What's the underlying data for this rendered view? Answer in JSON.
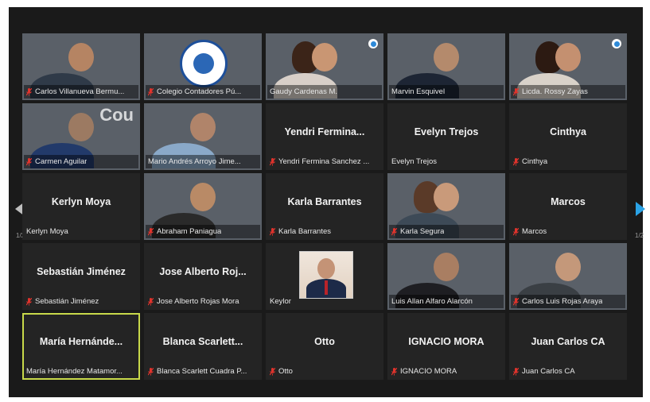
{
  "window": {
    "page_indicator_left": "1/2",
    "page_indicator_right": "1/2"
  },
  "participants": [
    {
      "id": "p1",
      "label": "Carlos Villanueva Bermu...",
      "big_name": "",
      "muted": true,
      "video": true,
      "bg": "bg-office",
      "skin": "#b58463",
      "shirt": "#2f3a48",
      "badge": false,
      "active": false,
      "name": "tile-carlos-villanueva"
    },
    {
      "id": "p2",
      "label": "Colegio Contadores Pú...",
      "big_name": "",
      "muted": true,
      "video": true,
      "bg": "bg-logo",
      "logo": true,
      "badge": false,
      "active": false,
      "name": "tile-colegio-contadores"
    },
    {
      "id": "p3",
      "label": "Gaudy Cardenas M.",
      "big_name": "",
      "muted": false,
      "video": true,
      "bg": "bg-white",
      "skin": "#c99673",
      "shirt": "#d8cfc8",
      "hair": "#3b2418",
      "badge": true,
      "active": false,
      "name": "tile-gaudy-cardenas"
    },
    {
      "id": "p4",
      "label": "Marvin Esquivel",
      "big_name": "",
      "muted": false,
      "video": true,
      "bg": "bg-building",
      "skin": "#b48a6c",
      "shirt": "#1d2534",
      "badge": false,
      "active": false,
      "name": "tile-marvin-esquivel"
    },
    {
      "id": "p5",
      "label": "Licda. Rossy Zayas",
      "big_name": "",
      "muted": true,
      "video": true,
      "bg": "bg-white",
      "skin": "#c49070",
      "shirt": "#d9d2c9",
      "hair": "#2c1a12",
      "badge": true,
      "active": false,
      "name": "tile-rossy-zayas"
    },
    {
      "id": "p6",
      "label": "Carmen Aguilar",
      "big_name": "",
      "muted": true,
      "video": true,
      "bg": "bg-blue",
      "skin": "#9c7a62",
      "shirt": "#223a6a",
      "wordmark": "Cou",
      "badge": false,
      "active": false,
      "name": "tile-carmen-aguilar"
    },
    {
      "id": "p7",
      "label": "Mario Andrés Arroyo Jime...",
      "big_name": "",
      "muted": false,
      "video": true,
      "bg": "bg-white",
      "skin": "#b0846a",
      "shirt": "#8aa9c9",
      "badge": false,
      "active": false,
      "name": "tile-mario-arroyo"
    },
    {
      "id": "p8",
      "label": "Yendri Fermina Sanchez ...",
      "big_name": "Yendri Fermina...",
      "muted": true,
      "video": false,
      "badge": false,
      "active": false,
      "name": "tile-yendri-fermina"
    },
    {
      "id": "p9",
      "label": "Evelyn Trejos",
      "big_name": "Evelyn Trejos",
      "muted": false,
      "video": false,
      "badge": false,
      "active": false,
      "name": "tile-evelyn-trejos"
    },
    {
      "id": "p10",
      "label": "Cinthya",
      "big_name": "Cinthya",
      "muted": true,
      "video": false,
      "badge": false,
      "active": false,
      "name": "tile-cinthya"
    },
    {
      "id": "p11",
      "label": "Kerlyn Moya",
      "big_name": "Kerlyn Moya",
      "muted": false,
      "video": false,
      "badge": false,
      "active": false,
      "name": "tile-kerlyn-moya"
    },
    {
      "id": "p12",
      "label": "Abraham Paniagua",
      "big_name": "",
      "muted": true,
      "video": true,
      "bg": "bg-warm",
      "skin": "#b98a66",
      "shirt": "#2a2a2a",
      "badge": false,
      "active": false,
      "name": "tile-abraham-paniagua"
    },
    {
      "id": "p13",
      "label": "Karla Barrantes",
      "big_name": "Karla Barrantes",
      "muted": true,
      "video": false,
      "badge": false,
      "active": false,
      "name": "tile-karla-barrantes"
    },
    {
      "id": "p14",
      "label": "Karla Segura",
      "big_name": "",
      "muted": true,
      "video": true,
      "bg": "bg-shelf",
      "skin": "#c99a7a",
      "shirt": "#3d4a57",
      "hair": "#5a3a28",
      "badge": false,
      "active": false,
      "name": "tile-karla-segura"
    },
    {
      "id": "p15",
      "label": "Marcos",
      "big_name": "Marcos",
      "muted": true,
      "video": false,
      "badge": false,
      "active": false,
      "name": "tile-marcos"
    },
    {
      "id": "p16",
      "label": "Sebastián Jiménez",
      "big_name": "Sebastián Jiménez",
      "muted": true,
      "video": false,
      "badge": false,
      "active": false,
      "name": "tile-sebastian-jimenez"
    },
    {
      "id": "p17",
      "label": "Jose Alberto Rojas Mora",
      "big_name": "Jose Alberto Roj...",
      "muted": true,
      "video": false,
      "badge": false,
      "active": false,
      "name": "tile-jose-alberto-rojas"
    },
    {
      "id": "p18",
      "label": "Keylor",
      "big_name": "",
      "muted": false,
      "video": false,
      "portrait": true,
      "badge": false,
      "active": false,
      "name": "tile-keylor"
    },
    {
      "id": "p19",
      "label": "Luis Allan Alfaro Alarcón",
      "big_name": "",
      "muted": false,
      "video": true,
      "bg": "bg-room",
      "skin": "#a97e62",
      "shirt": "#1e1e22",
      "badge": false,
      "active": false,
      "name": "tile-luis-alfaro"
    },
    {
      "id": "p20",
      "label": "Carlos Luis Rojas Araya",
      "big_name": "",
      "muted": true,
      "video": true,
      "bg": "bg-beige",
      "skin": "#c4987a",
      "shirt": "#3a3f44",
      "badge": false,
      "active": false,
      "name": "tile-carlos-rojas"
    },
    {
      "id": "p21",
      "label": "María Hernández Matamor...",
      "big_name": "María Hernánde...",
      "muted": false,
      "video": false,
      "badge": false,
      "active": true,
      "name": "tile-maria-hernandez"
    },
    {
      "id": "p22",
      "label": "Blanca Scarlett Cuadra P...",
      "big_name": "Blanca Scarlett...",
      "muted": true,
      "video": false,
      "badge": false,
      "active": false,
      "name": "tile-blanca-scarlett"
    },
    {
      "id": "p23",
      "label": "Otto",
      "big_name": "Otto",
      "muted": true,
      "video": false,
      "badge": false,
      "active": false,
      "name": "tile-otto"
    },
    {
      "id": "p24",
      "label": "IGNACIO MORA",
      "big_name": "IGNACIO MORA",
      "muted": true,
      "video": false,
      "badge": false,
      "active": false,
      "name": "tile-ignacio-mora"
    },
    {
      "id": "p25",
      "label": "Juan Carlos CA",
      "big_name": "Juan Carlos CA",
      "muted": true,
      "video": false,
      "badge": false,
      "active": false,
      "name": "tile-juan-carlos-ca"
    }
  ],
  "colors": {
    "muted_icon": "#e0332c",
    "active_border": "#c8d94a",
    "next_arrow": "#2aa3e6"
  }
}
